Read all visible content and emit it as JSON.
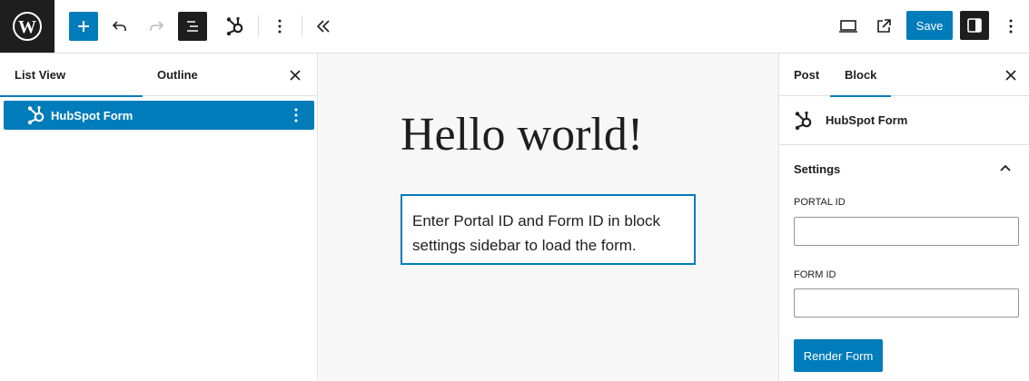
{
  "toolbar": {
    "save_label": "Save",
    "icons": [
      "wordpress-logo",
      "plus-icon",
      "undo-icon",
      "redo-icon",
      "list-view-icon",
      "hubspot-icon",
      "more-vertical-icon",
      "chevron-double-left-icon",
      "desktop-preview-icon",
      "external-link-icon",
      "sidebar-toggle-icon",
      "more-vertical-icon"
    ]
  },
  "left_panel": {
    "tabs": [
      {
        "label": "List View",
        "active": true
      },
      {
        "label": "Outline",
        "active": false
      }
    ],
    "items": [
      {
        "label": "HubSpot Form",
        "selected": true
      }
    ]
  },
  "canvas": {
    "title": "Hello world!",
    "block_message": "Enter Portal ID and Form ID in block settings sidebar to load the form."
  },
  "sidebar": {
    "tabs": [
      {
        "label": "Post",
        "active": false
      },
      {
        "label": "Block",
        "active": true
      }
    ],
    "block_name": "HubSpot Form",
    "panel_title": "Settings",
    "portal_id_label": "PORTAL ID",
    "portal_id_value": "",
    "form_id_label": "FORM ID",
    "form_id_value": "",
    "render_button_label": "Render Form"
  },
  "colors": {
    "accent": "#007cba",
    "dark": "#1e1e1e",
    "canvas_bg": "#f7f7f7"
  }
}
